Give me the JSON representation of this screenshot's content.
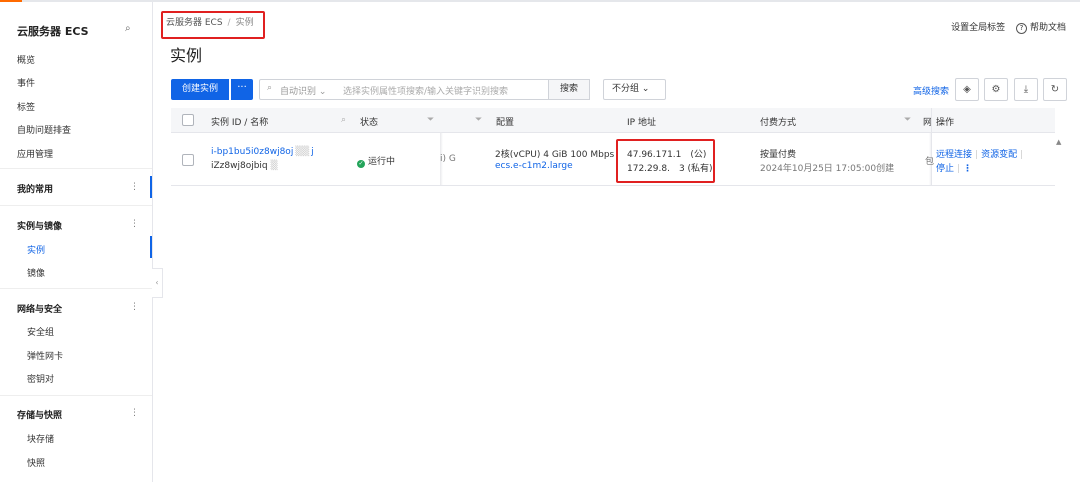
{
  "sidebar": {
    "title": "云服务器 ECS",
    "items": [
      "概览",
      "事件",
      "标签",
      "自助问题排查",
      "应用管理"
    ],
    "favorites": "我的常用",
    "groups": [
      {
        "label": "实例与镜像",
        "items": [
          "实例",
          "镜像"
        ]
      },
      {
        "label": "网络与安全",
        "items": [
          "安全组",
          "弹性网卡",
          "密钥对"
        ]
      },
      {
        "label": "存储与快照",
        "items": [
          "块存储",
          "快照"
        ]
      }
    ],
    "dots": "⋮",
    "collapse": "‹"
  },
  "breadcrumb": {
    "root": "云服务器 ECS",
    "sep": "/",
    "current": "实例"
  },
  "page_title": "实例",
  "top_right": {
    "tags": "设置全局标签",
    "help_icon": "?",
    "docs": "帮助文档"
  },
  "toolbar": {
    "create": "创建实例",
    "more": "···",
    "search_mode": "自动识别 ⌄",
    "search_placeholder": "选择实例属性项搜索/输入关键字识别搜索",
    "search_button": "搜索",
    "group_select": "不分组 ⌄",
    "advanced": "高级搜索",
    "icons": [
      "◈",
      "⚙",
      "⤓",
      "↻"
    ]
  },
  "table": {
    "headers": [
      "实例 ID / 名称",
      "状态",
      "配置",
      "IP 地址",
      "付费方式",
      "操作"
    ],
    "header_cut": "网",
    "row": {
      "id": "i-bp1bu5i0z8wj8oj",
      "id_tail": "j",
      "name": "iZz8wj8ojbiq",
      "status": "运行中",
      "zone_cut": "i)  G",
      "config": "2核(vCPU)  4 GiB 100 Mbps",
      "spec": "ecs.e-c1m2.large",
      "ip_public": "47.96.171.1  (公)",
      "ip_private": "172.29.8.  3 (私有)",
      "billing": "按量付费",
      "created": "2024年10月25日 17:05:00创建",
      "cut_char": "包",
      "ops": [
        "远程连接",
        "资源变配",
        "停止",
        "⋮"
      ]
    }
  }
}
